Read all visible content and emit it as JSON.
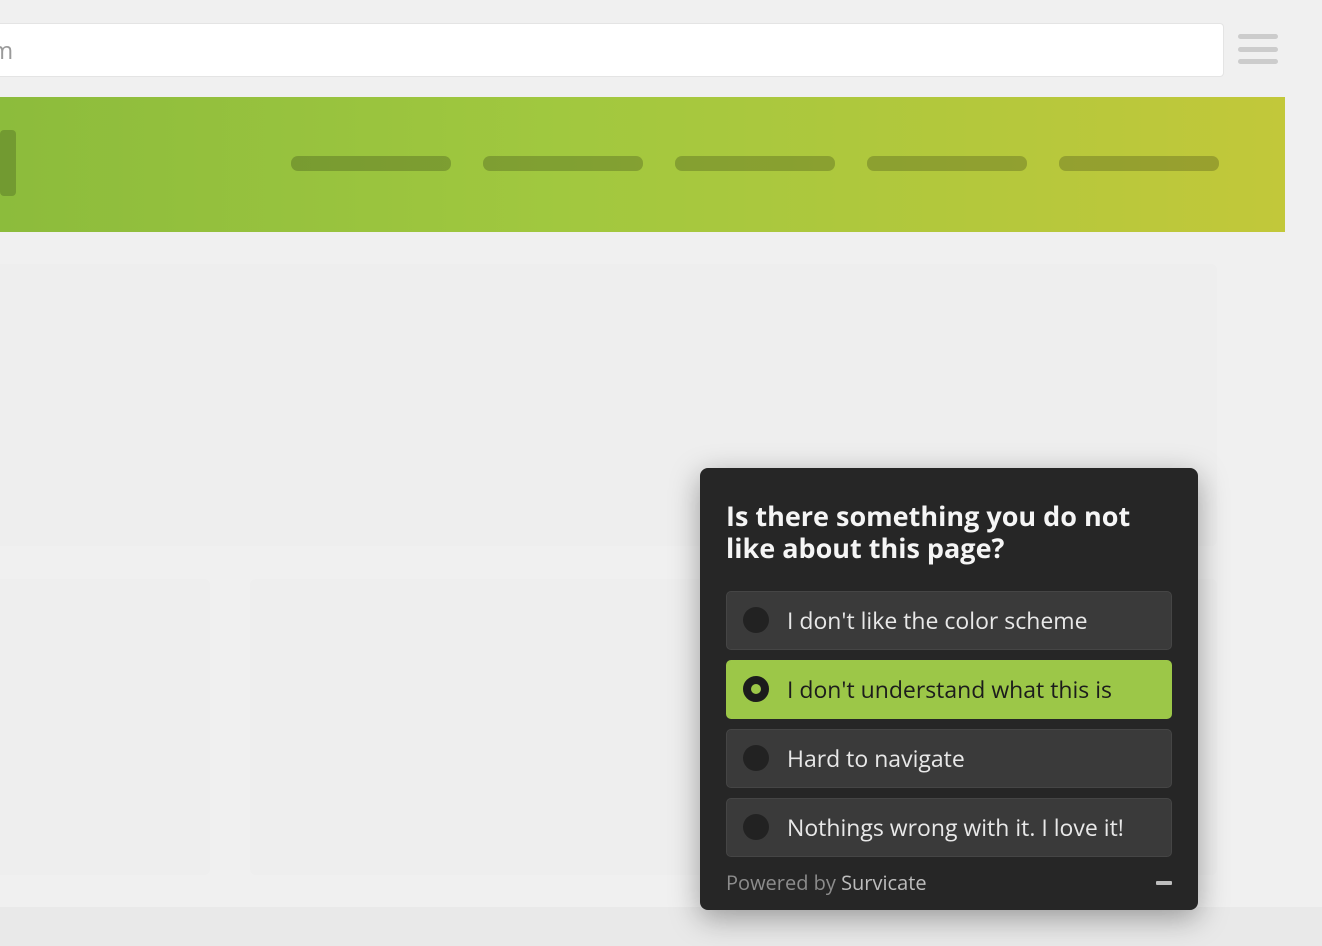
{
  "topbar": {
    "partial_text": "m"
  },
  "survey": {
    "question": "Is there something you do not like about this page?",
    "options": [
      {
        "label": "I don't like the color scheme",
        "selected": false
      },
      {
        "label": "I don't understand what this is",
        "selected": true
      },
      {
        "label": "Hard to navigate",
        "selected": false
      },
      {
        "label": "Nothings wrong with it. I love it!",
        "selected": false
      }
    ],
    "powered_prefix": "Powered by ",
    "powered_brand": "Survicate"
  }
}
